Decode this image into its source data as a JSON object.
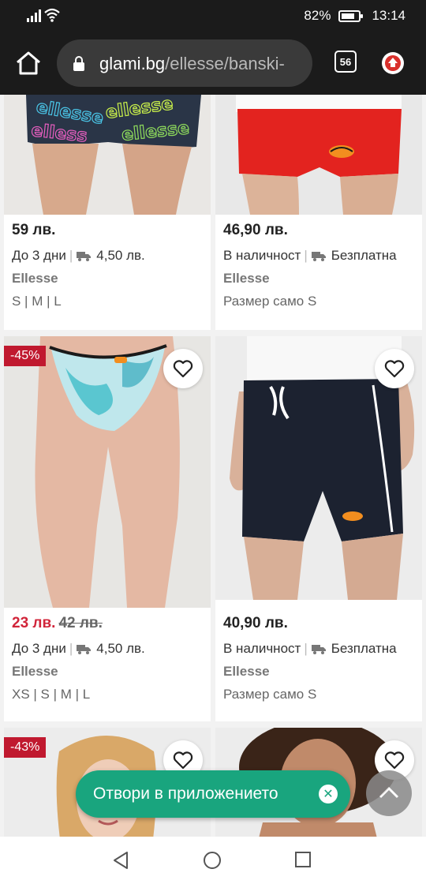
{
  "status_bar": {
    "battery": "82%",
    "battery_level": 0.82,
    "time": "13:14"
  },
  "browser": {
    "url_host": "glami.bg",
    "url_path": "/ellesse/banski-",
    "tab_count": "56"
  },
  "products": [
    {
      "price": "59 лв.",
      "old_price": "",
      "availability": "До 3 дни",
      "shipping": "4,50 лв.",
      "brand": "Ellesse",
      "sizes": "S | M | L"
    },
    {
      "price": "46,90 лв.",
      "old_price": "",
      "availability": "В наличност",
      "shipping": "Безплатна",
      "brand": "Ellesse",
      "sizes": "Размер само S"
    },
    {
      "discount": "-45%",
      "price": "23 лв.",
      "old_price": "42 лв.",
      "availability": "До 3 дни",
      "shipping": "4,50 лв.",
      "brand": "Ellesse",
      "sizes": "XS | S | M | L"
    },
    {
      "price": "40,90 лв.",
      "old_price": "",
      "availability": "В наличност",
      "shipping": "Безплатна",
      "brand": "Ellesse",
      "sizes": "Размер само S"
    },
    {
      "discount": "-43%"
    },
    {}
  ],
  "open_app_button": "Отвори в приложението",
  "colors": {
    "accent_green": "#19a57e",
    "sale_red": "#d1253a",
    "badge_red": "#c0192f",
    "dark_bar": "#1b1b1b"
  }
}
